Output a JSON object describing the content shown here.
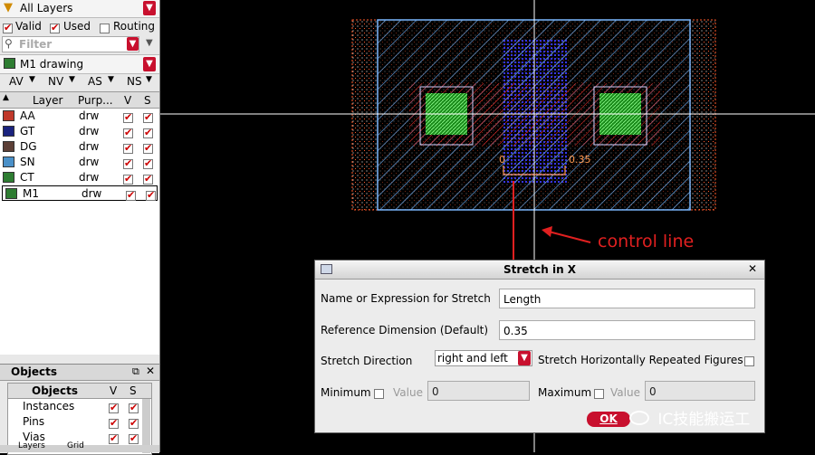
{
  "left_panel": {
    "layer_filter_label": "All Layers",
    "valid_label": "Valid",
    "used_label": "Used",
    "routing_label": "Routing",
    "filter_placeholder": "Filter",
    "current_layer": "M1 drawing",
    "tabs": [
      "AV",
      "NV",
      "AS",
      "NS"
    ],
    "layer_table": {
      "headers": [
        "Layer",
        "Purp...",
        "V",
        "S"
      ],
      "rows": [
        {
          "layer": "AA",
          "purpose": "drw",
          "color": "#c0392b"
        },
        {
          "layer": "GT",
          "purpose": "drw",
          "color": "#1a237e"
        },
        {
          "layer": "DG",
          "purpose": "drw",
          "color": "#5d4037"
        },
        {
          "layer": "SN",
          "purpose": "drw",
          "color": "#4a90c8"
        },
        {
          "layer": "CT",
          "purpose": "drw",
          "color": "#2e7d32"
        },
        {
          "layer": "M1",
          "purpose": "drw",
          "color": "#2e7d32"
        }
      ]
    },
    "objects_panel": {
      "title": "Objects",
      "headers": [
        "Objects",
        "V",
        "S"
      ],
      "rows": [
        "Instances",
        "Pins",
        "Vias"
      ]
    },
    "bottom_tabs": [
      "Layers",
      "Grid"
    ]
  },
  "canvas": {
    "label_left": "0",
    "label_right": "0.35",
    "annotation": "control line"
  },
  "dialog": {
    "title": "Stretch in X",
    "name_label": "Name or Expression for Stretch",
    "name_value": "Length",
    "ref_label": "Reference Dimension (Default)",
    "ref_value": "0.35",
    "direction_label": "Stretch Direction",
    "direction_value": "right and left",
    "repeat_label": "Stretch Horizontally Repeated Figures",
    "minimum_label": "Minimum",
    "maximum_label": "Maximum",
    "value_label": "Value",
    "min_value": "0",
    "max_value": "0",
    "ok_label": "OK"
  },
  "watermark": "IC技能搬运工"
}
